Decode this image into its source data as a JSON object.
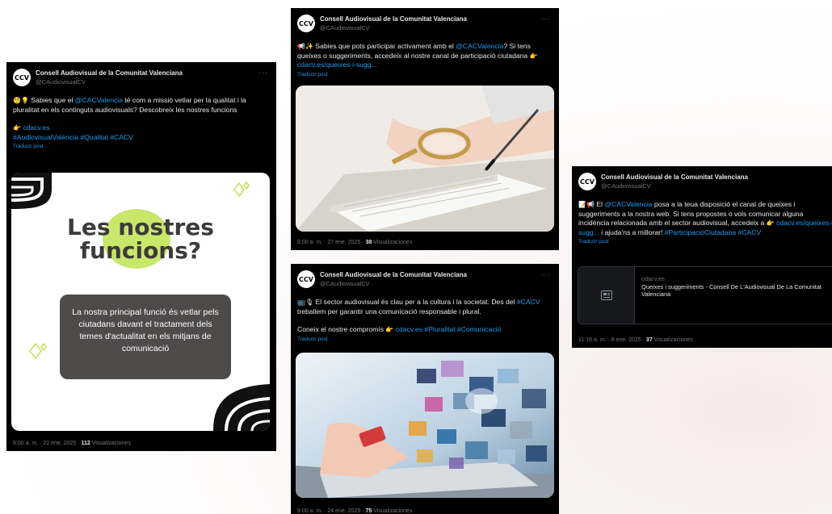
{
  "account": {
    "name": "Consell Audiovisual de la Comunitat Valenciana",
    "handle": "@CAudiovisualCV",
    "avatar_text": "CCV",
    "more": "···"
  },
  "translate_label": "Traducir post",
  "tweets": [
    {
      "text_a": " Sabies que el ",
      "mention": "@CACValencia",
      "text_b": " té com a missió vetlar per la qualitat i la pluralitat en els continguts audiovisuals? Descobreix les nostres funcions",
      "link": "cdacv.es",
      "hashtags": "#AudiovisualValència #Qualitat #CACV",
      "meta_prefix": "9:00 a. m. · 22 ene. 2025 · ",
      "views_count": "112",
      "views_label": " Visualizaciones",
      "graphic": {
        "title_line1": "Les nostres",
        "title_line2": "funcions?",
        "box_text": "La nostra principal funció és vetlar pels ciutadans davant el tractament dels temes d'actualitat en els mitjans de comunicació"
      }
    },
    {
      "text_a": " Sabies que pots participar activament amb el ",
      "mention": "@CACValencia",
      "text_b": "? Si tens queixes o suggeriments, accedeix al nostre canal de participació ciutadana ",
      "link": "cdacv.es/queixes-i-sugg...",
      "meta_prefix": "9:00 a. m. · 27 ene. 2025 · ",
      "views_count": "38",
      "views_label": " Visualizaciones"
    },
    {
      "text_a": " El sector audiovisual és clau per a la cultura i la societat. Des del ",
      "mention": "#CACV",
      "text_b": " treballem per garantir una comunicació responsable i plural.",
      "text_c": "Coneix el nostre compromís ",
      "link": "cdacv.es",
      "hashtags": "#Pluralitat #Comunicació",
      "meta_prefix": "9:00 a. m. · 24 ene. 2025 · ",
      "views_count": "75",
      "views_label": " Visualizaciones"
    },
    {
      "text_a": " El ",
      "mention": "@CACValencia",
      "text_b": " posa a la teua disposició el canal de queixes i suggeriments a la nostra web. Si tens propostes o vols comunicar alguna incidència relacionada amb el sector audiovisual, accedeix a ",
      "link": "cdacv.es/queixes-i-sugg...",
      "text_c": " i ajuda'ns a millorar! ",
      "hashtags": "#ParticipacióCiutadana #CACV",
      "card_domain": "cdacv.es",
      "card_title": "Queixes i suggeriments - Consell De L'Audiovisual De La Comunitat Valenciana",
      "meta_prefix": "11:16 a. m. · 8 ene. 2025 · ",
      "views_count": "37",
      "views_label": " Visualizaciones"
    }
  ],
  "colors": {
    "tweet_bg": "#000000",
    "link": "#1d9bf0",
    "muted": "#71767b",
    "lime": "#c7e86b",
    "box_gray": "#4d4a4a"
  }
}
